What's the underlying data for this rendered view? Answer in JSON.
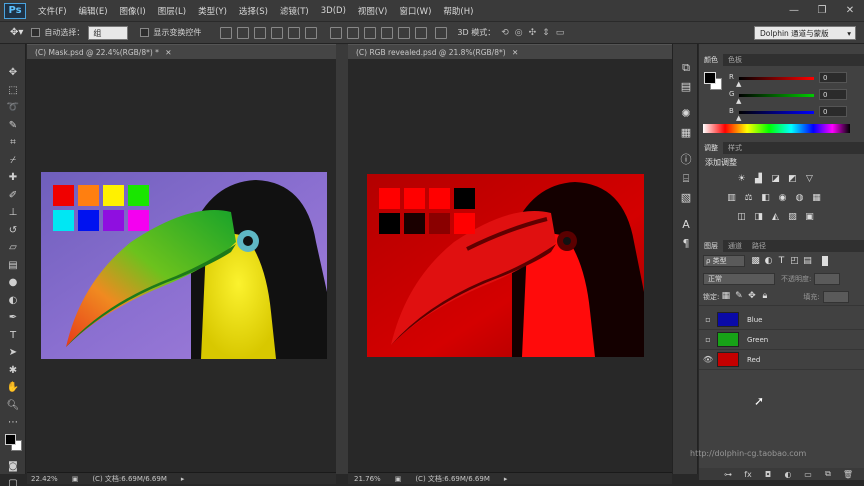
{
  "app": {
    "logo": "Ps",
    "menu": [
      "文件(F)",
      "编辑(E)",
      "图像(I)",
      "图层(L)",
      "类型(Y)",
      "选择(S)",
      "滤镜(T)",
      "3D(D)",
      "视图(V)",
      "窗口(W)",
      "帮助(H)"
    ],
    "window_controls": [
      "minimize-icon",
      "maximize-icon",
      "close-icon"
    ]
  },
  "options": {
    "auto_select_label": "自动选择：",
    "auto_select_value": "组",
    "show_transform_label": "显示变换控件",
    "mode_3d_label": "3D 模式：",
    "workspace": "Dolphin 通道与蒙版"
  },
  "documents": [
    {
      "tab": "(C) Mask.psd @ 22.4%(RGB/8*) *",
      "zoom": "22.42%",
      "doc_info": "(C) 文档:6.69M/6.69M",
      "variant": "color"
    },
    {
      "tab": "(C) RGB revealed.psd @ 21.8%(RGB/8*)",
      "zoom": "21.76%",
      "doc_info": "(C) 文档:6.69M/6.69M",
      "variant": "red"
    }
  ],
  "swatches_color": [
    "#f00000",
    "#ff7f10",
    "#fff100",
    "#19e600",
    "#00e7f3",
    "#0012f0",
    "#8f0fe0",
    "#f400f0"
  ],
  "swatches_red": [
    "#ff0000",
    "#ff0000",
    "#ff0000",
    "#000000",
    "#000000",
    "#1a0000",
    "#8a0000",
    "#ff0000"
  ],
  "color_panel": {
    "tabs": [
      "颜色",
      "色板"
    ],
    "channels": [
      {
        "label": "R",
        "value": "0",
        "track": "linear-gradient(to right,#000,#f00)"
      },
      {
        "label": "G",
        "value": "0",
        "track": "linear-gradient(to right,#000,#0c0)"
      },
      {
        "label": "B",
        "value": "0",
        "track": "linear-gradient(to right,#000,#00f)"
      }
    ]
  },
  "adjust_panel": {
    "tabs": [
      "调整",
      "样式"
    ],
    "title": "添加调整"
  },
  "layers_panel": {
    "tabs": [
      "图层",
      "通道",
      "路径"
    ],
    "filter_kind": "ρ 类型",
    "blend_mode": "正常",
    "opacity_label": "不透明度:",
    "lock_label": "锁定:",
    "fill_label": "填充:",
    "layers": [
      {
        "name": "Blue",
        "visible": false,
        "thumb": "#0a0aa8"
      },
      {
        "name": "Green",
        "visible": false,
        "thumb": "#17a317"
      },
      {
        "name": "Red",
        "visible": true,
        "thumb": "#c40000"
      }
    ]
  },
  "watermark": "http://dolphin-cg.taobao.com"
}
